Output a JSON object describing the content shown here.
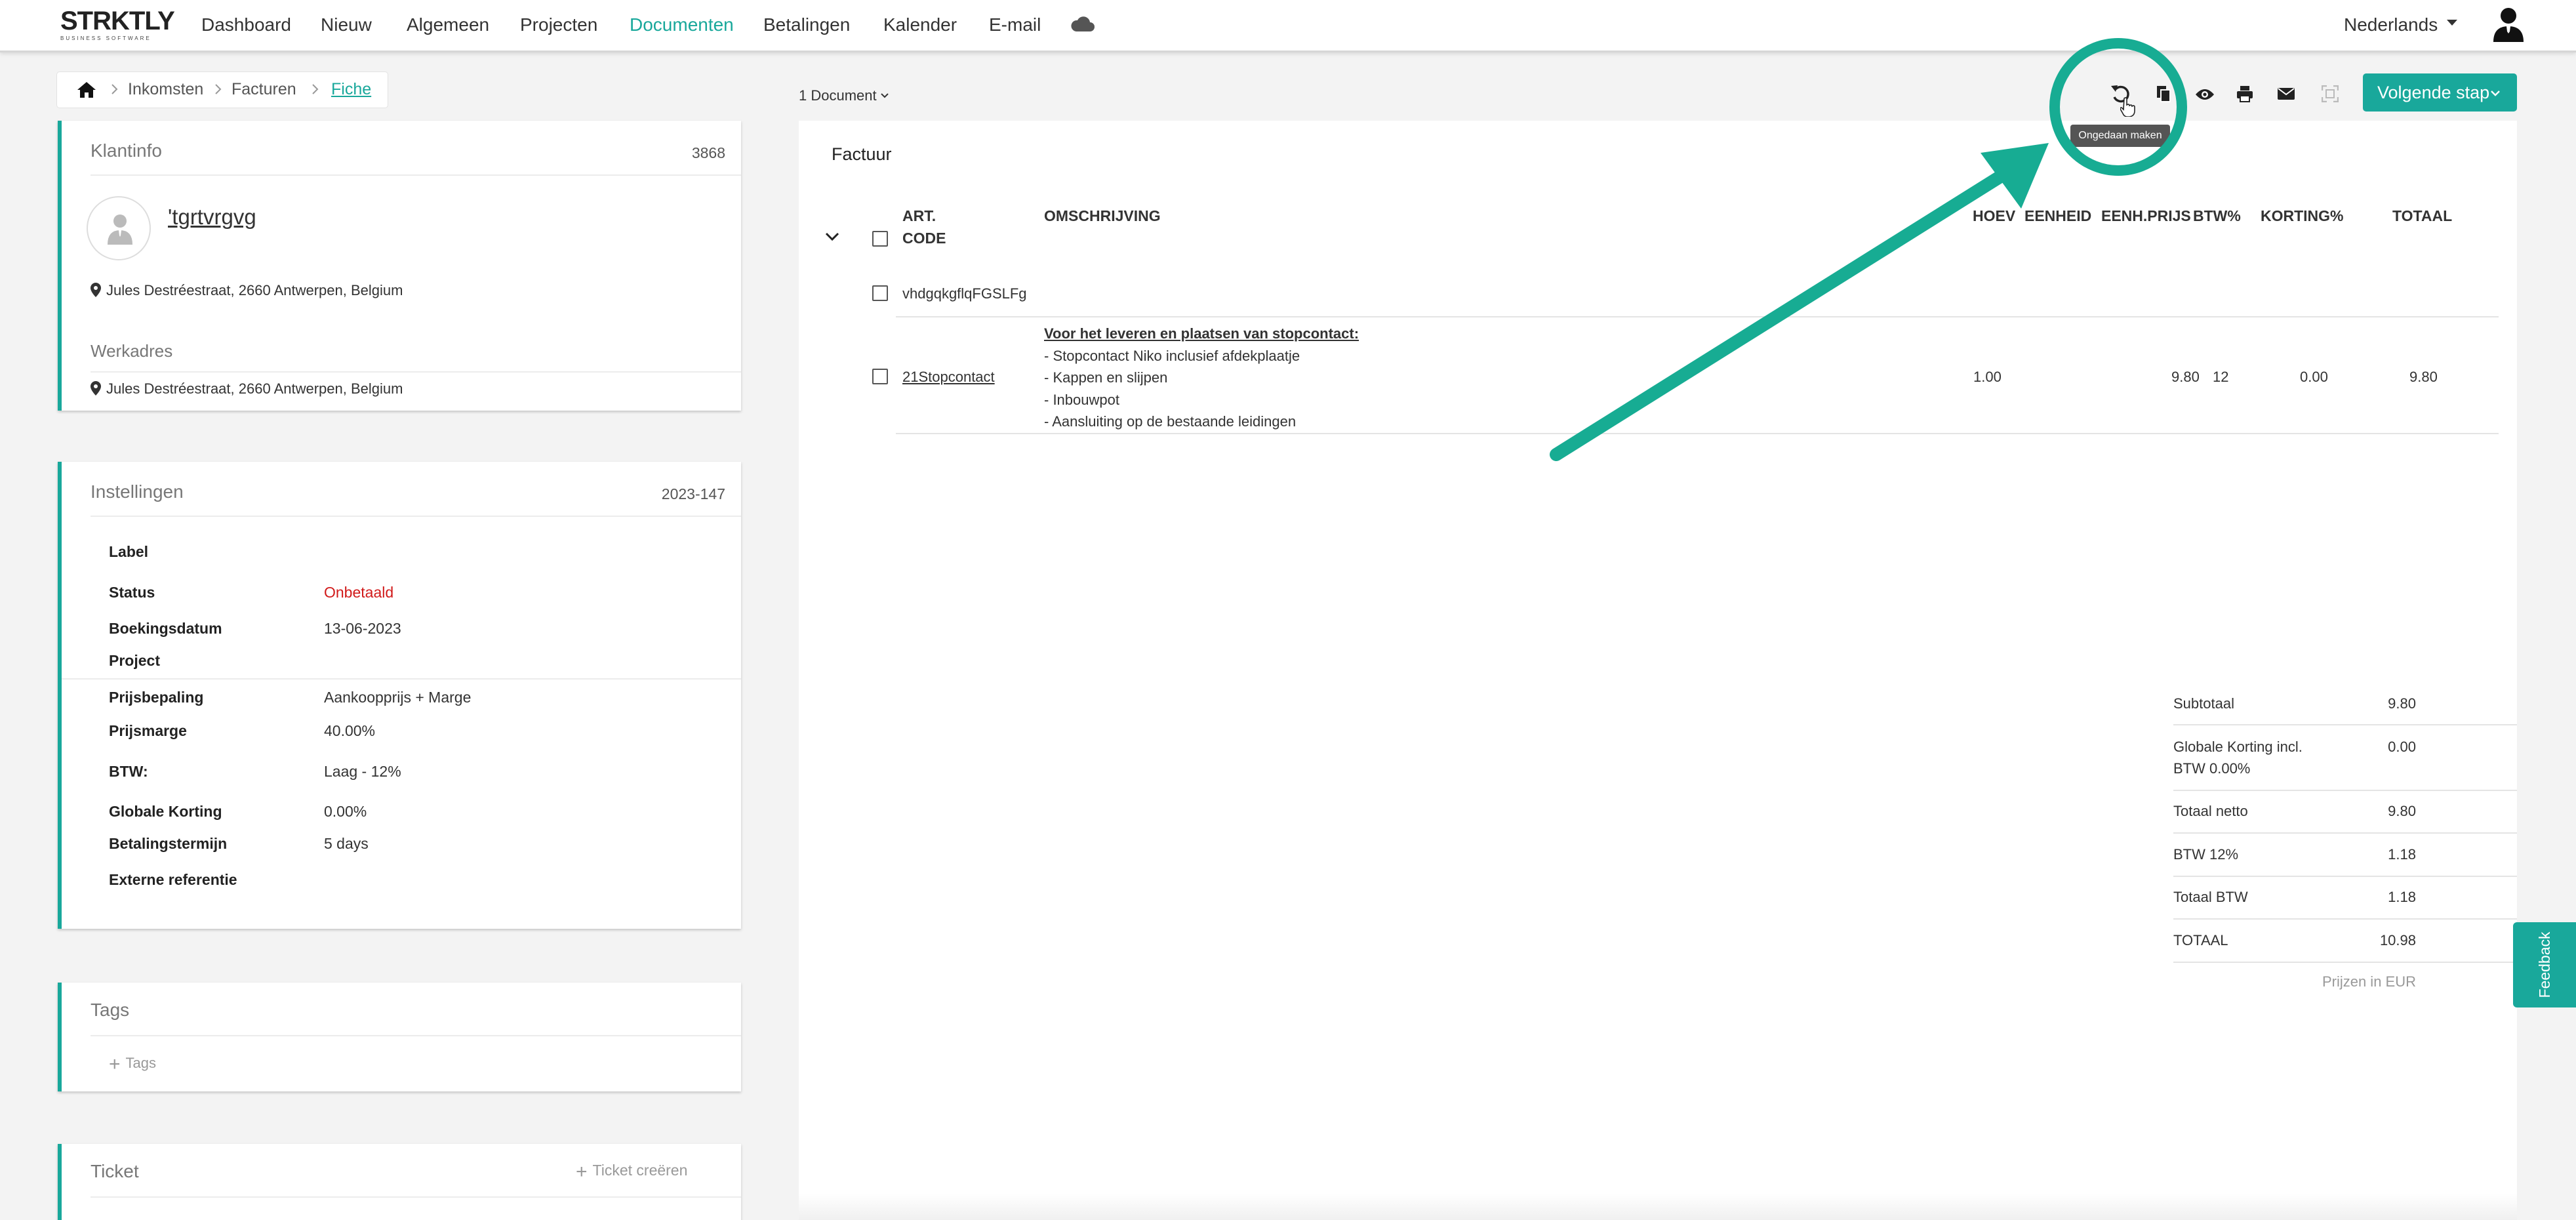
{
  "navbar": {
    "logo": "STRKTLY",
    "logo_sub": "BUSINESS SOFTWARE",
    "items": [
      "Dashboard",
      "Nieuw",
      "Algemeen",
      "Projecten",
      "Documenten",
      "Betalingen",
      "Kalender",
      "E-mail"
    ],
    "active": "Documenten",
    "language": "Nederlands",
    "icons": [
      "cloud-icon",
      "user-icon",
      "chevron-down-icon"
    ]
  },
  "breadcrumb": {
    "items": [
      "Inkomsten",
      "Facturen",
      "Fiche"
    ]
  },
  "client": {
    "title": "Klantinfo",
    "number": "3868",
    "name": "'tgrtvrgvg",
    "address": "Jules Destréestraat, 2660 Antwerpen, Belgium",
    "work_label": "Werkadres",
    "work_address": "Jules Destréestraat, 2660 Antwerpen, Belgium"
  },
  "settings": {
    "title": "Instellingen",
    "number": "2023-147",
    "rows": [
      {
        "label": "Label",
        "value": ""
      },
      {
        "label": "Status",
        "value": "Onbetaald"
      },
      {
        "label": "Boekingsdatum",
        "value": "13-06-2023"
      },
      {
        "label": "Project",
        "value": ""
      },
      {
        "label": "Prijsbepaling",
        "value": "Aankoopprijs + Marge"
      },
      {
        "label": "Prijsmarge",
        "value": "40.00%"
      },
      {
        "label": "BTW:",
        "value": "Laag - 12%"
      },
      {
        "label": "Globale Korting",
        "value": "0.00%"
      },
      {
        "label": "Betalingstermijn",
        "value": "5 days"
      },
      {
        "label": "Externe referentie",
        "value": ""
      }
    ],
    "status_color": "#d11a1a"
  },
  "tags": {
    "title": "Tags",
    "add_label": "Tags"
  },
  "ticket": {
    "title": "Ticket",
    "create_label": "Ticket creëren"
  },
  "toolbar": {
    "doc_count": "1 Document",
    "next_step": "Volgende stap",
    "tooltip": "Ongedaan maken",
    "icons": [
      "undo-icon",
      "copy-icon",
      "eye-icon",
      "print-icon",
      "mail-icon",
      "scan-icon"
    ]
  },
  "document": {
    "title": "Factuur",
    "headers": {
      "code_line1": "ART.",
      "code_line2": "CODE",
      "description": "OMSCHRIJVING",
      "qty": "HOEV",
      "unit": "EENHEID",
      "unit_price": "EENH.PRIJS",
      "vat": "BTW%",
      "discount": "KORTING%",
      "total": "TOTAAL"
    },
    "group_row": "vhdgqkgflqFGSLFg",
    "line": {
      "code": "21Stopcontact",
      "description_title": "Voor het leveren en plaatsen van stopcontact:",
      "description_lines": [
        "- Stopcontact Niko inclusief afdekplaatje",
        "- Kappen en slijpen",
        "- Inbouwpot",
        "- Aansluiting op de bestaande leidingen"
      ],
      "qty": "1.00",
      "unit": "",
      "unit_price": "9.80",
      "vat": "12",
      "discount": "0.00",
      "total": "9.80"
    }
  },
  "totals": {
    "rows": [
      {
        "label": "Subtotaal",
        "value": "9.80"
      },
      {
        "label": "Globale Korting incl.",
        "label2": "BTW 0.00%",
        "value": "0.00"
      },
      {
        "label": "Totaal netto",
        "value": "9.80"
      },
      {
        "label": "BTW 12%",
        "value": "1.18"
      },
      {
        "label": "Totaal BTW",
        "value": "1.18"
      },
      {
        "label": "TOTAAL",
        "value": "10.98"
      }
    ],
    "currency_note": "Prijzen in EUR"
  },
  "feedback": "Feedback",
  "colors": {
    "accent": "#19a89b",
    "annotation": "#17ac93",
    "danger": "#d11a1a"
  }
}
